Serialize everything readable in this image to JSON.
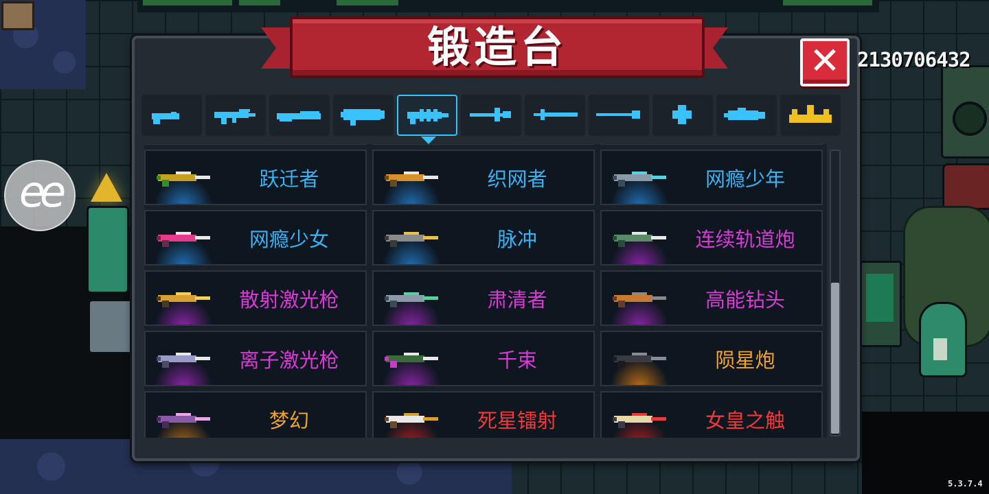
{
  "panel": {
    "title": "锻造台",
    "close_label": "✕"
  },
  "hud": {
    "gems": "2130706432",
    "version": "5.3.7.4"
  },
  "overlay": {
    "label": "ee"
  },
  "tabs": [
    {
      "id": "pistol",
      "icon": "pistol-icon",
      "active": false
    },
    {
      "id": "assault-rifle",
      "icon": "assault-rifle-icon",
      "active": false
    },
    {
      "id": "shotgun",
      "icon": "shotgun-icon",
      "active": false
    },
    {
      "id": "rocket-launcher",
      "icon": "rocket-launcher-icon",
      "active": false
    },
    {
      "id": "laser",
      "icon": "laser-gun-icon",
      "active": true
    },
    {
      "id": "bow",
      "icon": "bow-icon",
      "active": false
    },
    {
      "id": "sword",
      "icon": "sword-icon",
      "active": false
    },
    {
      "id": "spear",
      "icon": "spear-icon",
      "active": false
    },
    {
      "id": "throwing",
      "icon": "shuriken-icon",
      "active": false
    },
    {
      "id": "fish",
      "icon": "fish-icon",
      "active": false
    },
    {
      "id": "special",
      "icon": "crown-icon",
      "active": false
    }
  ],
  "rarity_colors": {
    "blue": "#3ab2f2",
    "purple": "#d93ad6",
    "orange": "#f2a22e",
    "red": "#f23838",
    "accent": "#3ac2ff"
  },
  "weapons": [
    {
      "name": "跃迁者",
      "rarity": "blue",
      "palette": [
        "#c8a020",
        "#3a8a2a",
        "#e8e8e8"
      ]
    },
    {
      "name": "织网者",
      "rarity": "blue",
      "palette": [
        "#d89028",
        "#6a4a20",
        "#e8e8e8"
      ]
    },
    {
      "name": "网瘾少年",
      "rarity": "blue",
      "palette": [
        "#8a9aa8",
        "#3a4a58",
        "#5ad0e0"
      ]
    },
    {
      "name": "网瘾少女",
      "rarity": "blue",
      "palette": [
        "#e83a8a",
        "#6a2a4a",
        "#e8e8e8"
      ]
    },
    {
      "name": "脉冲",
      "rarity": "blue",
      "palette": [
        "#8a8a8a",
        "#3a3a3a",
        "#e8c050"
      ]
    },
    {
      "name": "连续轨道炮",
      "rarity": "purple",
      "palette": [
        "#5a8a6a",
        "#2a4a3a",
        "#e8e8e8"
      ]
    },
    {
      "name": "散射激光枪",
      "rarity": "purple",
      "palette": [
        "#d8a030",
        "#4a3a20",
        "#f0d060"
      ]
    },
    {
      "name": "肃清者",
      "rarity": "purple",
      "palette": [
        "#8a9aa8",
        "#3a4a58",
        "#5ad0a0"
      ]
    },
    {
      "name": "高能钻头",
      "rarity": "purple",
      "palette": [
        "#c87a30",
        "#6a3a2a",
        "#8a8a8a"
      ]
    },
    {
      "name": "离子激光枪",
      "rarity": "purple",
      "palette": [
        "#9a9ac8",
        "#4a4a6a",
        "#e8e8e8"
      ]
    },
    {
      "name": "千束",
      "rarity": "purple",
      "palette": [
        "#3a6a3a",
        "#c83ac8",
        "#e8e8e8"
      ]
    },
    {
      "name": "陨星炮",
      "rarity": "orange",
      "palette": [
        "#3a3a42",
        "#1a1a20",
        "#8a8a9a"
      ]
    },
    {
      "name": "梦幻",
      "rarity": "orange",
      "palette": [
        "#8a5aa8",
        "#4a2a5a",
        "#e8a8e8"
      ]
    },
    {
      "name": "死星镭射",
      "rarity": "red",
      "palette": [
        "#e8e8e8",
        "#6a4a2a",
        "#d8a030"
      ]
    },
    {
      "name": "女皇之触",
      "rarity": "red",
      "palette": [
        "#e8d8a8",
        "#3a3a4a",
        "#e83a3a"
      ]
    }
  ]
}
